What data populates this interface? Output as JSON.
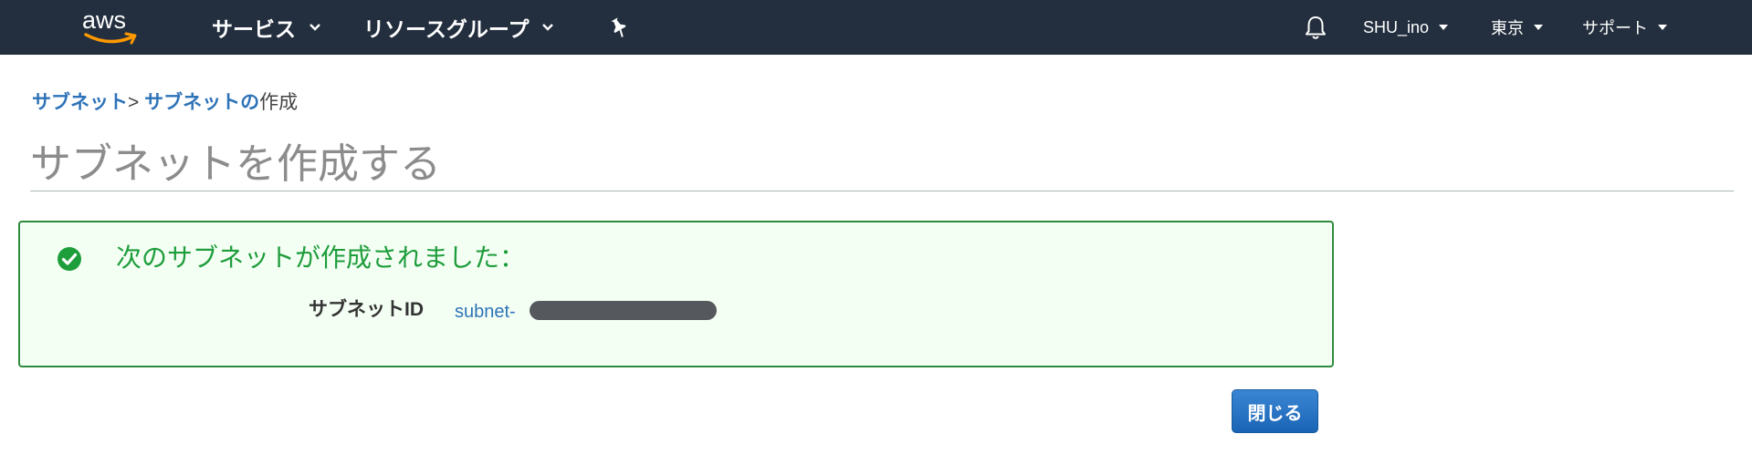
{
  "header": {
    "logo_text": "aws",
    "services_label": "サービス",
    "resource_groups_label": "リソースグループ",
    "pin_icon": "pin-icon",
    "bell_icon": "bell-icon",
    "account_label": "SHU_ino",
    "region_label": "東京",
    "support_label": "サポート"
  },
  "breadcrumb": {
    "item1": "サブネット",
    "separator": ">",
    "item2": "サブネットの",
    "item3": "作成"
  },
  "page": {
    "title": "サブネットを作成する"
  },
  "success": {
    "icon": "check-circle-icon",
    "message": "次のサブネットが作成されました：",
    "field_label": "サブネットID",
    "field_value": "subnet-"
  },
  "actions": {
    "close_label": "閉じる"
  },
  "colors": {
    "header_bg": "#232f3e",
    "link": "#2e73b8",
    "success_green": "#1e9d3b",
    "success_border": "#2e8b3d",
    "primary_button": "#1a64b5"
  }
}
